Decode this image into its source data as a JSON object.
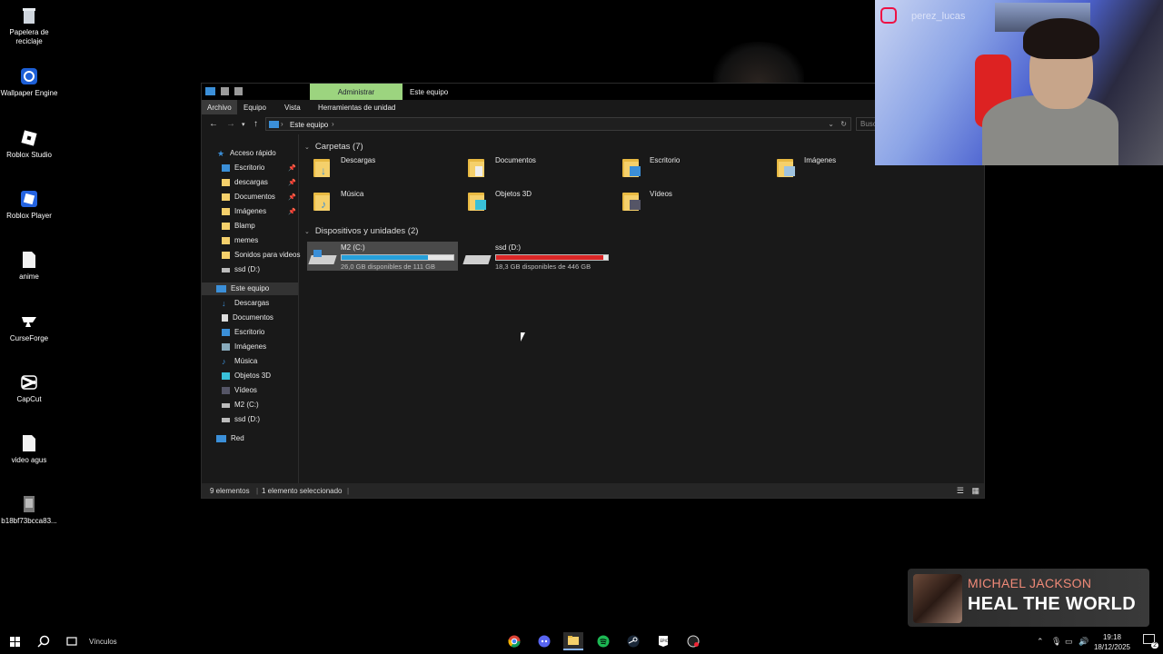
{
  "desktop": {
    "icons": [
      {
        "label": "Papelera de reciclaje",
        "icon": "recycle-bin-icon"
      },
      {
        "label": "Wallpaper Engine",
        "icon": "wallpaper-engine-icon"
      },
      {
        "label": "Roblox Studio",
        "icon": "roblox-studio-icon"
      },
      {
        "label": "Roblox Player",
        "icon": "roblox-player-icon"
      },
      {
        "label": "anime",
        "icon": "file-icon"
      },
      {
        "label": "CurseForge",
        "icon": "curseforge-icon"
      },
      {
        "label": "CapCut",
        "icon": "capcut-icon"
      },
      {
        "label": "video agus",
        "icon": "file-icon"
      },
      {
        "label": "b18bf73bcca83...",
        "icon": "image-file-icon"
      }
    ]
  },
  "explorer": {
    "ribbon_context_tab": "Administrar",
    "title": "Este equipo",
    "tabs": [
      "Archivo",
      "Equipo",
      "Vista",
      "Herramientas de unidad"
    ],
    "address": "Este equipo",
    "search_placeholder": "Busc",
    "sidebar": {
      "quick_access": "Acceso rápido",
      "quick_items": [
        "Escritorio",
        "descargas",
        "Documentos",
        "Imágenes",
        "Blamp",
        "memes",
        "Sonidos para videos",
        "ssd (D:)"
      ],
      "this_pc": "Este equipo",
      "pc_items": [
        "Descargas",
        "Documentos",
        "Escritorio",
        "Imágenes",
        "Música",
        "Objetos 3D",
        "Vídeos",
        "M2 (C:)",
        "ssd (D:)"
      ],
      "network": "Red"
    },
    "folders_header": "Carpetas (7)",
    "folders": [
      "Descargas",
      "Documentos",
      "Escritorio",
      "Imágenes",
      "Música",
      "Objetos 3D",
      "Vídeos"
    ],
    "devices_header": "Dispositivos y unidades (2)",
    "drives": [
      {
        "name": "M2 (C:)",
        "free": "26,0 GB disponibles de 111 GB",
        "used_fraction": 0.77,
        "bar_color": "#26a0da"
      },
      {
        "name": "ssd (D:)",
        "free": "18,3 GB disponibles de 446 GB",
        "used_fraction": 0.96,
        "bar_color": "#da2626"
      }
    ],
    "status_items": "9 elementos",
    "status_selected": "1 elemento seleccionado"
  },
  "overlay": {
    "instagram_handle": "perez_lucas",
    "music_artist": "MICHAEL JACKSON",
    "music_title": "HEAL THE WORLD"
  },
  "taskbar": {
    "links_label": "Vínculos",
    "time": "19:18",
    "date": "18/12/2025",
    "notification_count": "2"
  }
}
